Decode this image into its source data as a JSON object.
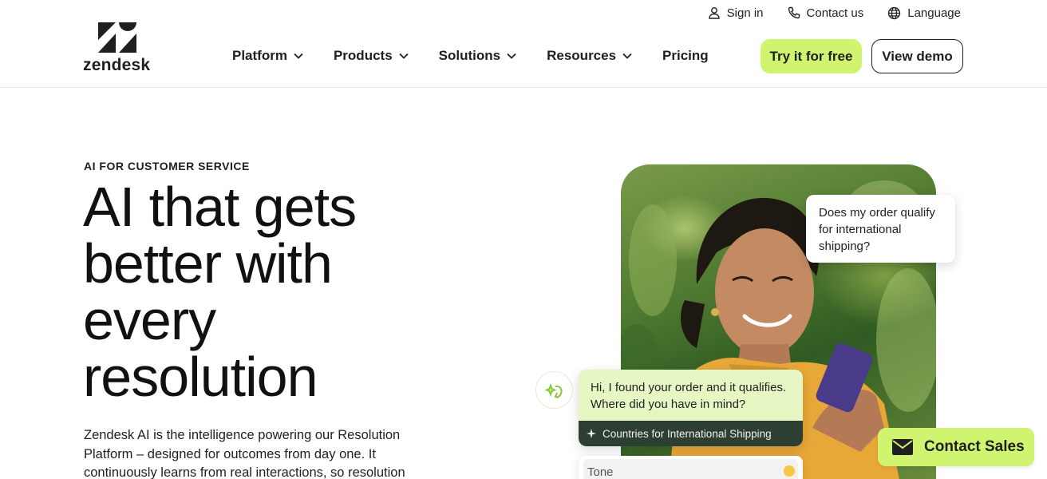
{
  "brand": {
    "wordmark": "zendesk",
    "accent": "#d1f470"
  },
  "utility_nav": [
    {
      "label": "Sign in",
      "icon": "user-icon"
    },
    {
      "label": "Contact us",
      "icon": "phone-icon"
    },
    {
      "label": "Language",
      "icon": "globe-icon"
    }
  ],
  "main_nav": [
    {
      "label": "Platform",
      "has_dropdown": true
    },
    {
      "label": "Products",
      "has_dropdown": true
    },
    {
      "label": "Solutions",
      "has_dropdown": true
    },
    {
      "label": "Resources",
      "has_dropdown": true
    },
    {
      "label": "Pricing",
      "has_dropdown": false
    }
  ],
  "header_ctas": {
    "primary": "Try it for free",
    "secondary": "View demo"
  },
  "hero": {
    "eyebrow": "AI FOR CUSTOMER SERVICE",
    "headline_lines": [
      "AI that gets",
      "better with",
      "every",
      "resolution"
    ],
    "body_lines": [
      "Zendesk AI is the intelligence powering our Resolution",
      "Platform – designed for outcomes from day one. It",
      "continuously learns from real interactions, so resolution"
    ]
  },
  "chat": {
    "customer_lines": [
      "Does my order qualify",
      "for international",
      "shipping?"
    ],
    "agent_lines": [
      "Hi, I found your order and it qualifies.",
      "Where did you have in mind?"
    ],
    "article_link": "Countries for International Shipping",
    "tone_label": "Tone"
  },
  "floating_cta": {
    "label": "Contact Sales",
    "icon": "envelope-icon"
  }
}
